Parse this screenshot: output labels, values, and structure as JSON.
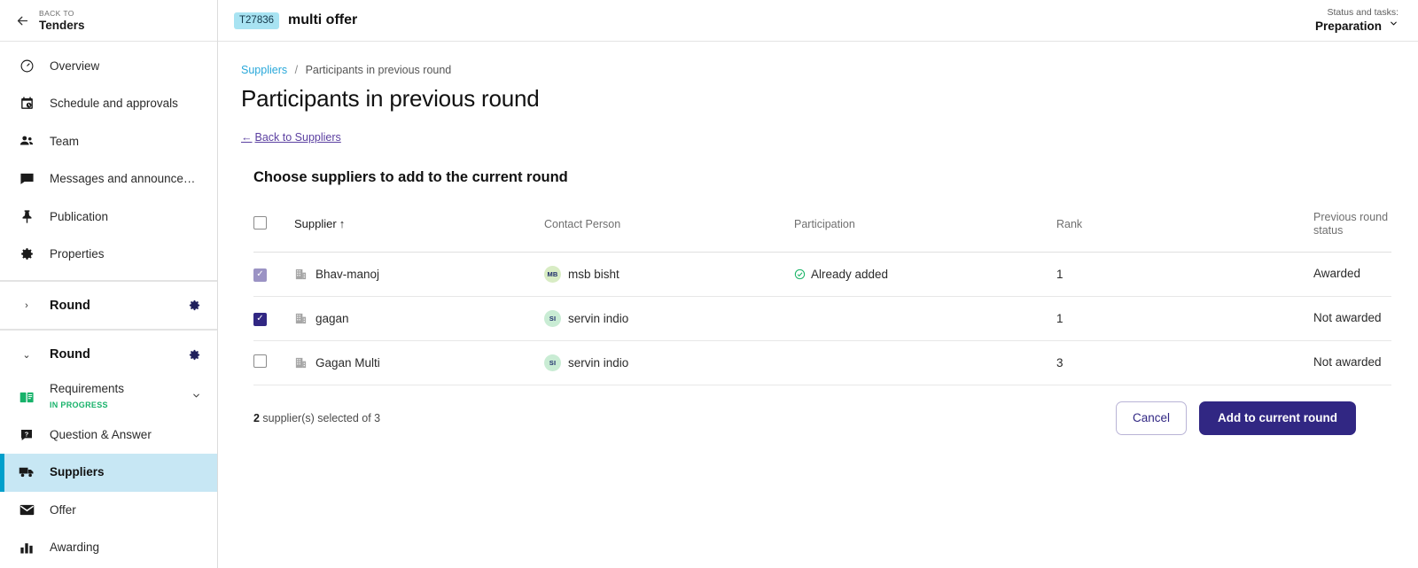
{
  "sidebar": {
    "back": {
      "kicker": "BACK TO",
      "title": "Tenders"
    },
    "top_items": [
      {
        "label": "Overview",
        "icon": "gauge-icon"
      },
      {
        "label": "Schedule and approvals",
        "icon": "calendar-clock-icon"
      },
      {
        "label": "Team",
        "icon": "people-icon"
      },
      {
        "label": "Messages and announcem...",
        "icon": "chat-icon"
      },
      {
        "label": "Publication",
        "icon": "pin-icon"
      },
      {
        "label": "Properties",
        "icon": "gear-icon"
      }
    ],
    "round_collapsed": {
      "label": "Round",
      "caret": "›"
    },
    "round_expanded": {
      "label": "Round",
      "caret": "⌄"
    },
    "round_items": [
      {
        "label": "Requirements",
        "status": "IN PROGRESS",
        "icon": "book-icon",
        "has_caret": true
      },
      {
        "label": "Question & Answer",
        "icon": "question-chat-icon",
        "has_caret": false
      },
      {
        "label": "Suppliers",
        "icon": "truck-icon",
        "has_caret": false,
        "active": true
      },
      {
        "label": "Offer",
        "icon": "envelope-icon",
        "has_caret": false
      },
      {
        "label": "Awarding",
        "icon": "bar-chart-icon",
        "has_caret": false
      }
    ]
  },
  "topbar": {
    "tender_id": "T27836",
    "tender_name": "multi offer",
    "status_kicker": "Status and tasks:",
    "status_value": "Preparation",
    "status_caret": "⌄"
  },
  "page": {
    "breadcrumb_root": "Suppliers",
    "breadcrumb_sep": "/",
    "breadcrumb_current": "Participants in previous round",
    "title": "Participants in previous round",
    "back_link": "Back to Suppliers",
    "back_link_arrow": "←",
    "section_title": "Choose suppliers to add to the current round"
  },
  "table": {
    "headers": {
      "supplier": "Supplier",
      "sort_arrow": "↑",
      "contact": "Contact Person",
      "participation": "Participation",
      "rank": "Rank",
      "previous_status": "Previous round status"
    },
    "select_all_checked": false,
    "rows": [
      {
        "checked": true,
        "disabled": true,
        "supplier": "Bhav-manoj",
        "contact_initials": "MB",
        "contact_name": "msb bisht",
        "participation": "Already added",
        "rank": "1",
        "previous_status": "Awarded"
      },
      {
        "checked": true,
        "disabled": false,
        "supplier": "gagan",
        "contact_initials": "SI",
        "contact_name": "servin indio",
        "participation": "",
        "rank": "1",
        "previous_status": "Not awarded"
      },
      {
        "checked": false,
        "disabled": false,
        "supplier": "Gagan Multi",
        "contact_initials": "SI",
        "contact_name": "servin indio",
        "participation": "",
        "rank": "3",
        "previous_status": "Not awarded"
      }
    ]
  },
  "footer": {
    "selected_count": "2",
    "selected_text": " supplier(s) selected of 3",
    "cancel_label": "Cancel",
    "primary_label": "Add to current round"
  },
  "colors": {
    "accent_cyan": "#009fcb",
    "active_bg": "#c7e7f4",
    "primary_indigo": "#312783",
    "link_purple": "#5b3fa0",
    "breadcrumb_blue": "#29a8da",
    "badge_cyan": "#a8e3f2",
    "status_green": "#17b26a"
  }
}
